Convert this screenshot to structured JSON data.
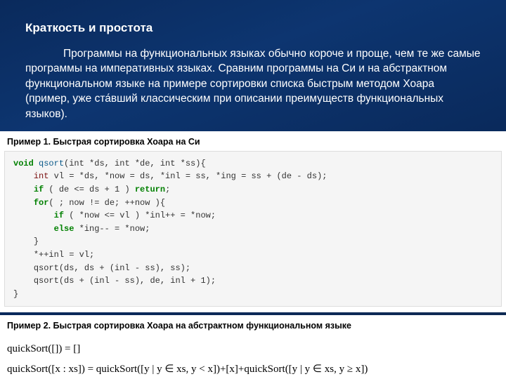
{
  "title": "Краткость и простота",
  "paragraph": "Программы на функциональных языках обычно короче и проще, чем те же самые программы на императивных языках. Сравним программы на Си и на абстрактном функциональном языке на примере сортировки списка быстрым методом Хоара (пример, уже ста́вший классическим при описании преимуществ функциональных языков).",
  "example1": {
    "caption": "Пример 1. Быстрая сортировка Хоара на Си",
    "c": {
      "kw_void": "void",
      "fn_qsort": "qsort",
      "sig_rest": "(int *ds, int *de, int *ss){",
      "type_int": "int",
      "decl_rest": " vl = *ds, *now = ds, *inl = ss, *ing = ss + (de - ds);",
      "kw_if": "if",
      "if_cond": " ( de <= ds + 1 ) ",
      "kw_return": "return",
      "semicolon": ";",
      "kw_for": "for",
      "for_head": "( ; now != de; ++now ){",
      "kw_if2": "if",
      "if2_rest": " ( *now <= vl ) *inl++ = *now;",
      "kw_else": "else",
      "else_rest": " *ing-- = *now;",
      "brace_close": "}",
      "line_assign": "*++inl = vl;",
      "line_call1": "qsort(ds, ds + (inl - ss), ss);",
      "line_call2": "qsort(ds + (inl - ss), de, inl + 1);",
      "brace_close2": "}"
    }
  },
  "example2": {
    "caption": "Пример 2. Быстрая сортировка Хоара на абстрактном функциональном языке",
    "line1": "quickSort([]) = []",
    "line2": "quickSort([x : xs]) = quickSort([y | y ∈ xs, y < x])+[x]+quickSort([y | y ∈ xs, y ≥ x])"
  }
}
